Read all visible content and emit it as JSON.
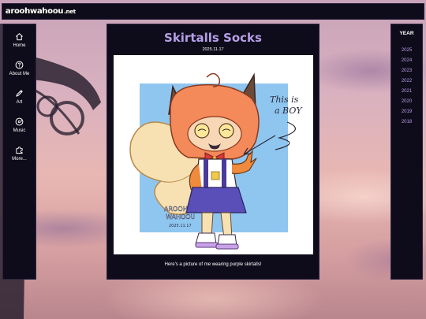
{
  "site": {
    "logo_text": "aroohwahoou",
    "logo_tld": ".net"
  },
  "nav": {
    "items": [
      {
        "label": "Home",
        "icon": "home-icon"
      },
      {
        "label": "About Me",
        "icon": "question-icon"
      },
      {
        "label": "Art",
        "icon": "brush-icon"
      },
      {
        "label": "Music",
        "icon": "music-disc-icon"
      },
      {
        "label": "More...",
        "icon": "puzzle-icon"
      }
    ]
  },
  "post": {
    "title": "Skirtalls Socks",
    "date": "2025.11.17",
    "caption": "Here's a picture of me wearing purple skirtalls!",
    "artwork": {
      "speech_text": [
        "This is",
        "a BOY"
      ],
      "signature": [
        "AROOH",
        "WAHOOU"
      ],
      "signature_date": "2025.11.17",
      "colors": {
        "bg_blue": "#8fc6f0",
        "fur": "#f08a3c",
        "hair": "#f4895a",
        "skirt": "#5a4fb8",
        "tail": "#f7e1b3"
      }
    }
  },
  "years": {
    "heading": "YEAR",
    "list": [
      "2025",
      "2024",
      "2023",
      "2022",
      "2021",
      "2020",
      "2019",
      "2018"
    ]
  },
  "theme": {
    "panel_bg": "#0e0c1a",
    "accent": "#b79ee8",
    "text": "#ffffff"
  }
}
